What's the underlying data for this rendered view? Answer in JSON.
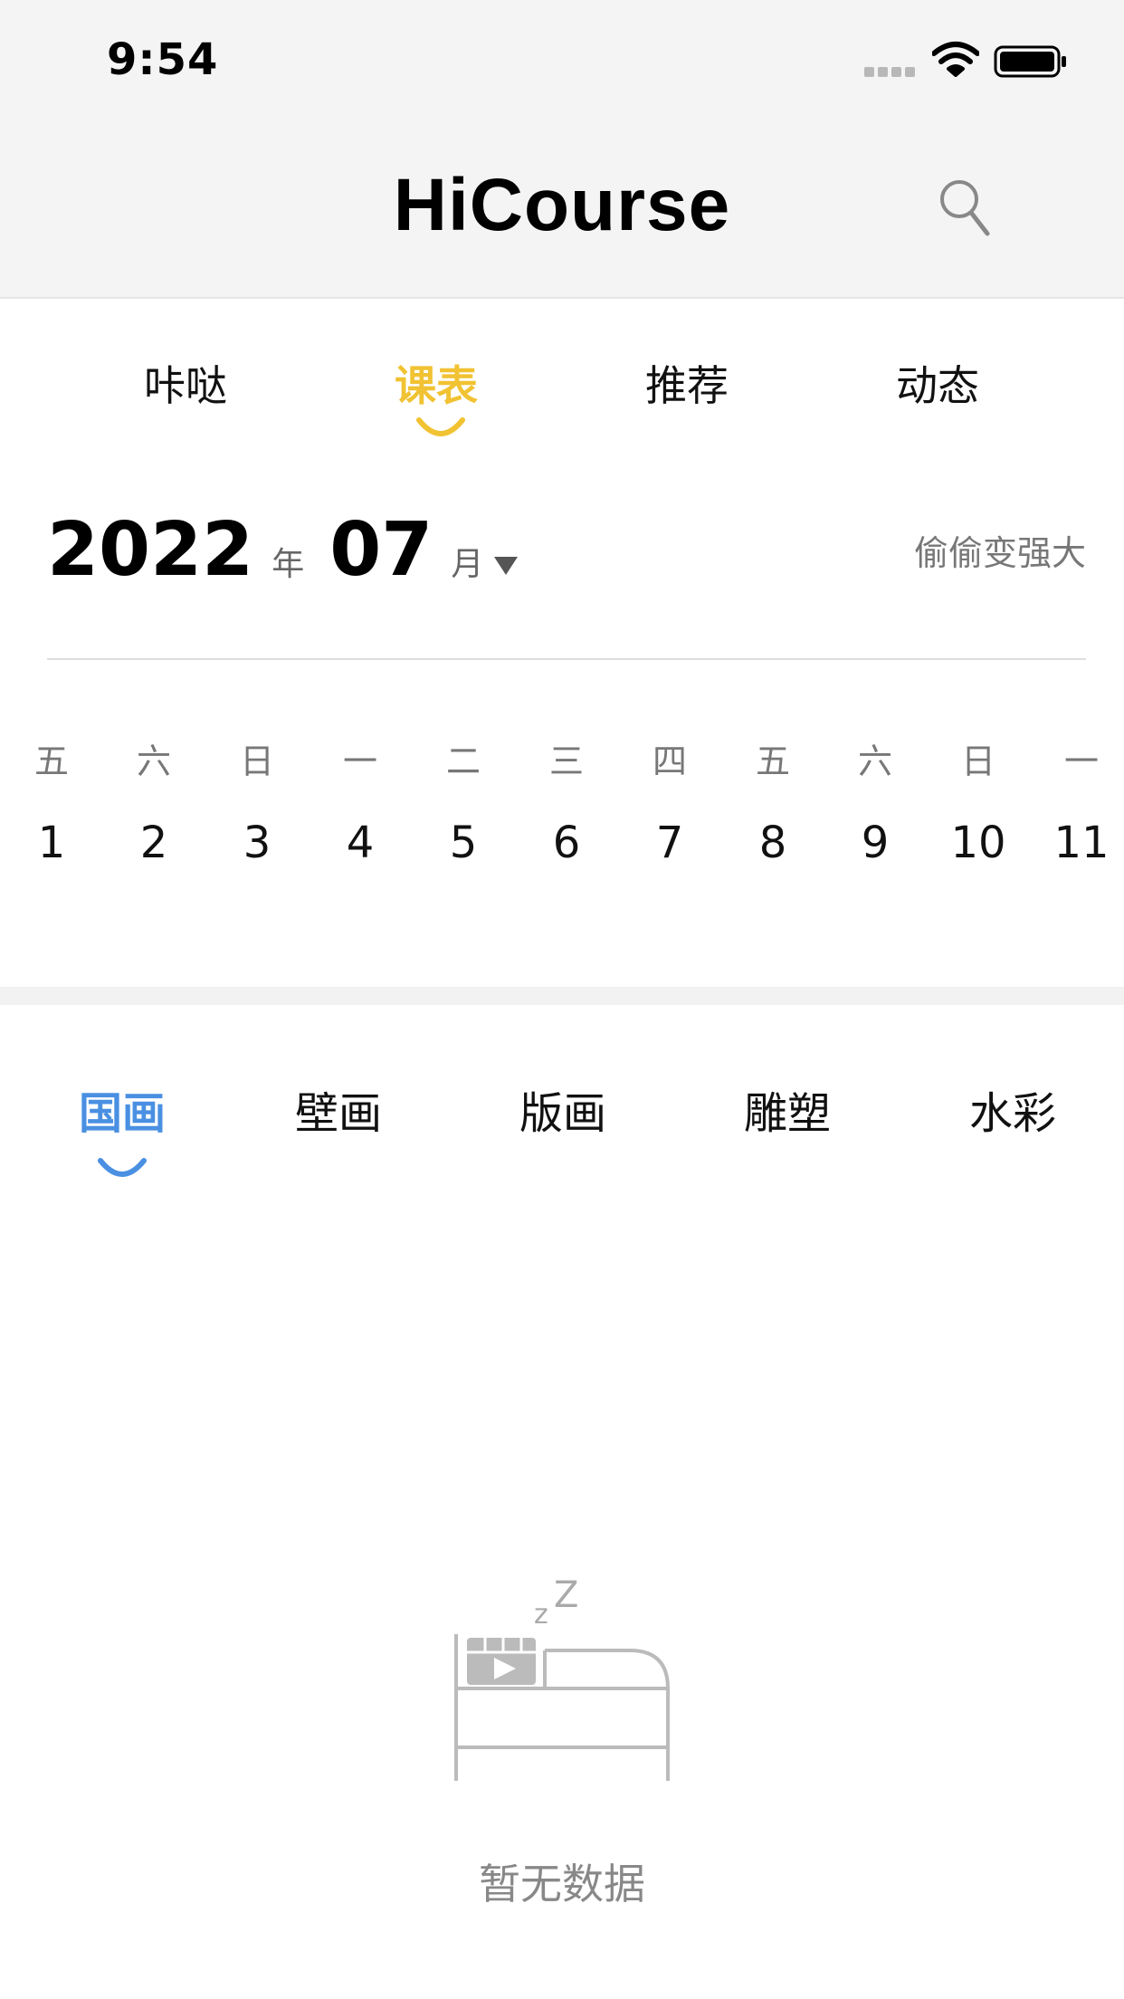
{
  "status_bar": {
    "time": "9:54"
  },
  "header": {
    "title": "HiCourse"
  },
  "main_tabs": [
    {
      "label": "咔哒"
    },
    {
      "label": "课表",
      "active": true
    },
    {
      "label": "推荐"
    },
    {
      "label": "动态"
    }
  ],
  "date_header": {
    "year": "2022",
    "year_unit": "年",
    "month": "07",
    "month_unit": "月",
    "motto": "偷偷变强大"
  },
  "calendar": {
    "days": [
      {
        "week": "五",
        "date": "1"
      },
      {
        "week": "六",
        "date": "2"
      },
      {
        "week": "日",
        "date": "3"
      },
      {
        "week": "一",
        "date": "4"
      },
      {
        "week": "二",
        "date": "5"
      },
      {
        "week": "三",
        "date": "6"
      },
      {
        "week": "四",
        "date": "7"
      },
      {
        "week": "五",
        "date": "8"
      },
      {
        "week": "六",
        "date": "9"
      },
      {
        "week": "日",
        "date": "10"
      },
      {
        "week": "一",
        "date": "11"
      }
    ]
  },
  "category_tabs": [
    {
      "label": "国画",
      "active": true
    },
    {
      "label": "壁画"
    },
    {
      "label": "版画"
    },
    {
      "label": "雕塑"
    },
    {
      "label": "水彩"
    }
  ],
  "empty_state": {
    "text": "暂无数据",
    "icon": "sleeping-bed-icon"
  },
  "colors": {
    "accent_yellow": "#f1c232",
    "accent_blue": "#4a90e2"
  }
}
